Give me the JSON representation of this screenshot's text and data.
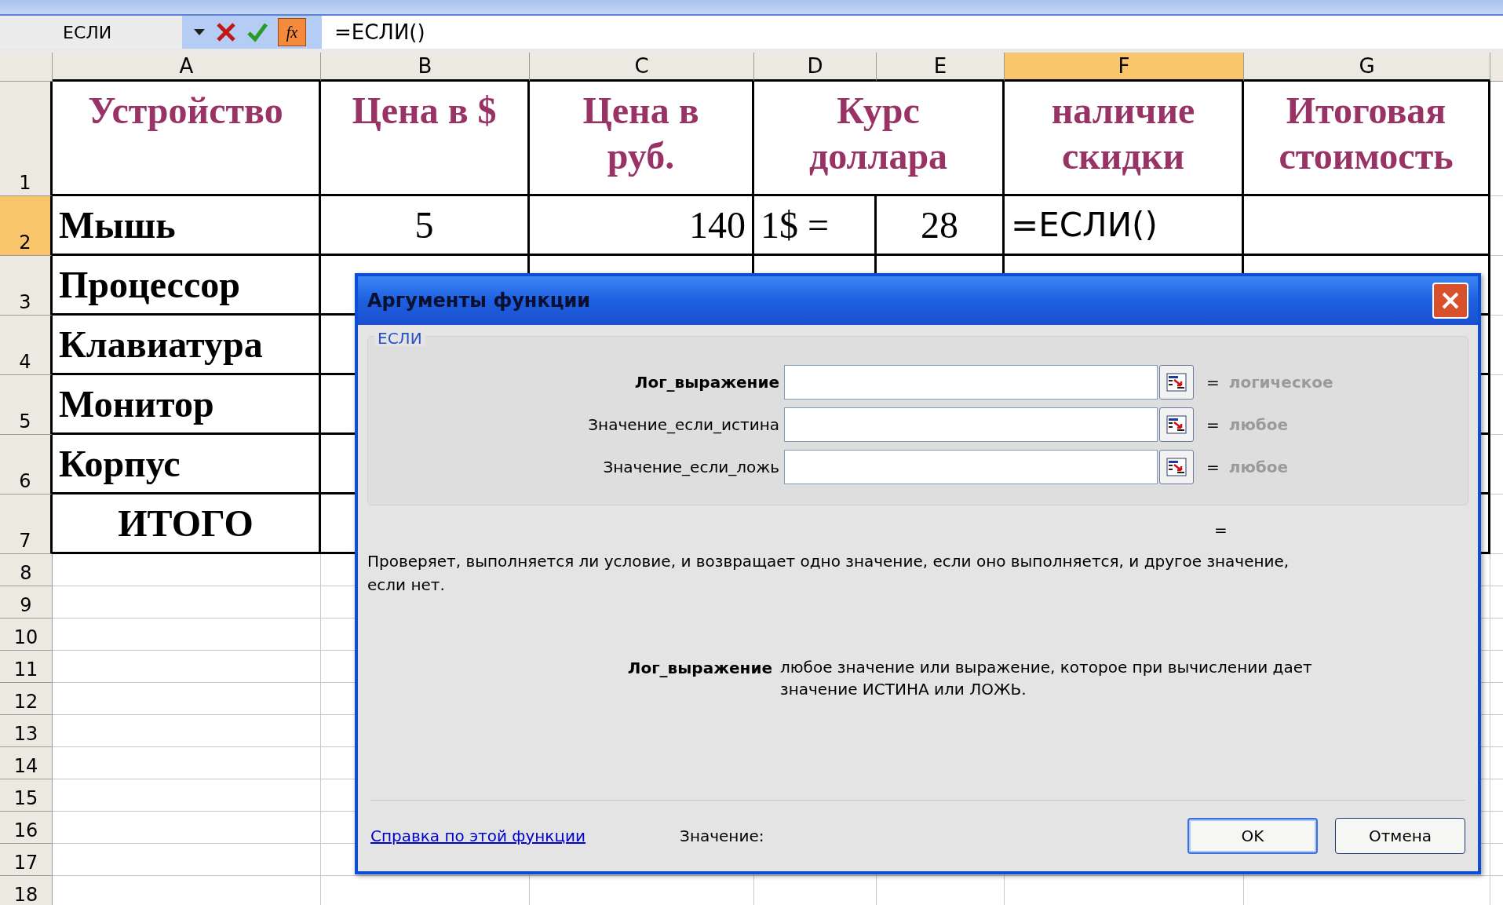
{
  "formula_bar": {
    "name_box": "ЕСЛИ",
    "fx_label": "fx",
    "formula": "=ЕСЛИ()"
  },
  "columns": [
    {
      "label": "A",
      "selected": false
    },
    {
      "label": "B",
      "selected": false
    },
    {
      "label": "C",
      "selected": false
    },
    {
      "label": "D",
      "selected": false
    },
    {
      "label": "E",
      "selected": false
    },
    {
      "label": "F",
      "selected": true
    },
    {
      "label": "G",
      "selected": false
    }
  ],
  "rows": [
    {
      "label": "1",
      "selected": false,
      "kind": "table",
      "cells": [
        {
          "text": "Устройство",
          "kind": "heading"
        },
        {
          "text": "Цена в $",
          "kind": "heading"
        },
        {
          "text": "Цена в руб.",
          "kind": "heading"
        },
        {
          "text": "Курс доллара",
          "kind": "heading",
          "merged": true
        },
        {
          "text": "наличие скидки",
          "kind": "heading"
        },
        {
          "text": "Итоговая стоимость",
          "kind": "heading"
        }
      ]
    },
    {
      "label": "2",
      "selected": true,
      "kind": "table",
      "cells": [
        {
          "text": "Мышь",
          "kind": "label"
        },
        {
          "text": "5",
          "kind": "number"
        },
        {
          "text": "140",
          "kind": "number"
        },
        {
          "text": "1$ =",
          "kind": "number"
        },
        {
          "text": "28",
          "kind": "number"
        },
        {
          "text": "=ЕСЛИ()",
          "kind": "edit"
        }
      ]
    },
    {
      "label": "3",
      "selected": false,
      "kind": "table",
      "cells": [
        {
          "text": "Процессор",
          "kind": "label"
        }
      ]
    },
    {
      "label": "4",
      "selected": false,
      "kind": "table",
      "cells": [
        {
          "text": "Клавиатура",
          "kind": "label"
        }
      ]
    },
    {
      "label": "5",
      "selected": false,
      "kind": "table",
      "cells": [
        {
          "text": "Монитор",
          "kind": "label"
        }
      ]
    },
    {
      "label": "6",
      "selected": false,
      "kind": "table",
      "cells": [
        {
          "text": "Корпус",
          "kind": "label"
        }
      ]
    },
    {
      "label": "7",
      "selected": false,
      "kind": "table",
      "cells": [
        {
          "text": "ИТОГО",
          "kind": "total"
        }
      ]
    },
    {
      "label": "8",
      "selected": false,
      "kind": "blank"
    },
    {
      "label": "9",
      "selected": false,
      "kind": "blank"
    },
    {
      "label": "10",
      "selected": false,
      "kind": "blank"
    },
    {
      "label": "11",
      "selected": false,
      "kind": "blank"
    },
    {
      "label": "12",
      "selected": false,
      "kind": "blank"
    },
    {
      "label": "13",
      "selected": false,
      "kind": "blank"
    },
    {
      "label": "14",
      "selected": false,
      "kind": "blank"
    },
    {
      "label": "15",
      "selected": false,
      "kind": "blank"
    },
    {
      "label": "16",
      "selected": false,
      "kind": "blank"
    },
    {
      "label": "17",
      "selected": false,
      "kind": "blank"
    },
    {
      "label": "18",
      "selected": false,
      "kind": "blank"
    }
  ],
  "dialog": {
    "title": "Аргументы функции",
    "function_name": "ЕСЛИ",
    "arguments": [
      {
        "label": "Лог_выражение",
        "selected": true,
        "equals": "=",
        "hint": "логическое"
      },
      {
        "label": "Значение_если_истина",
        "selected": false,
        "equals": "=",
        "hint": "любое"
      },
      {
        "label": "Значение_если_ложь",
        "selected": false,
        "equals": "=",
        "hint": "любое"
      }
    ],
    "result": "=",
    "description": "Проверяет, выполняется ли условие, и возвращает одно значение, если оно выполняется, и другое значение, если нет.",
    "arg_help": {
      "name": "Лог_выражение",
      "text": "любое значение или выражение, которое при вычислении дает значение ИСТИНА или ЛОЖЬ."
    },
    "help_link": "Справка по этой функции",
    "value_label": "Значение:",
    "buttons": [
      {
        "label": "OK",
        "default": true
      },
      {
        "label": "Отмена",
        "default": false
      }
    ]
  }
}
